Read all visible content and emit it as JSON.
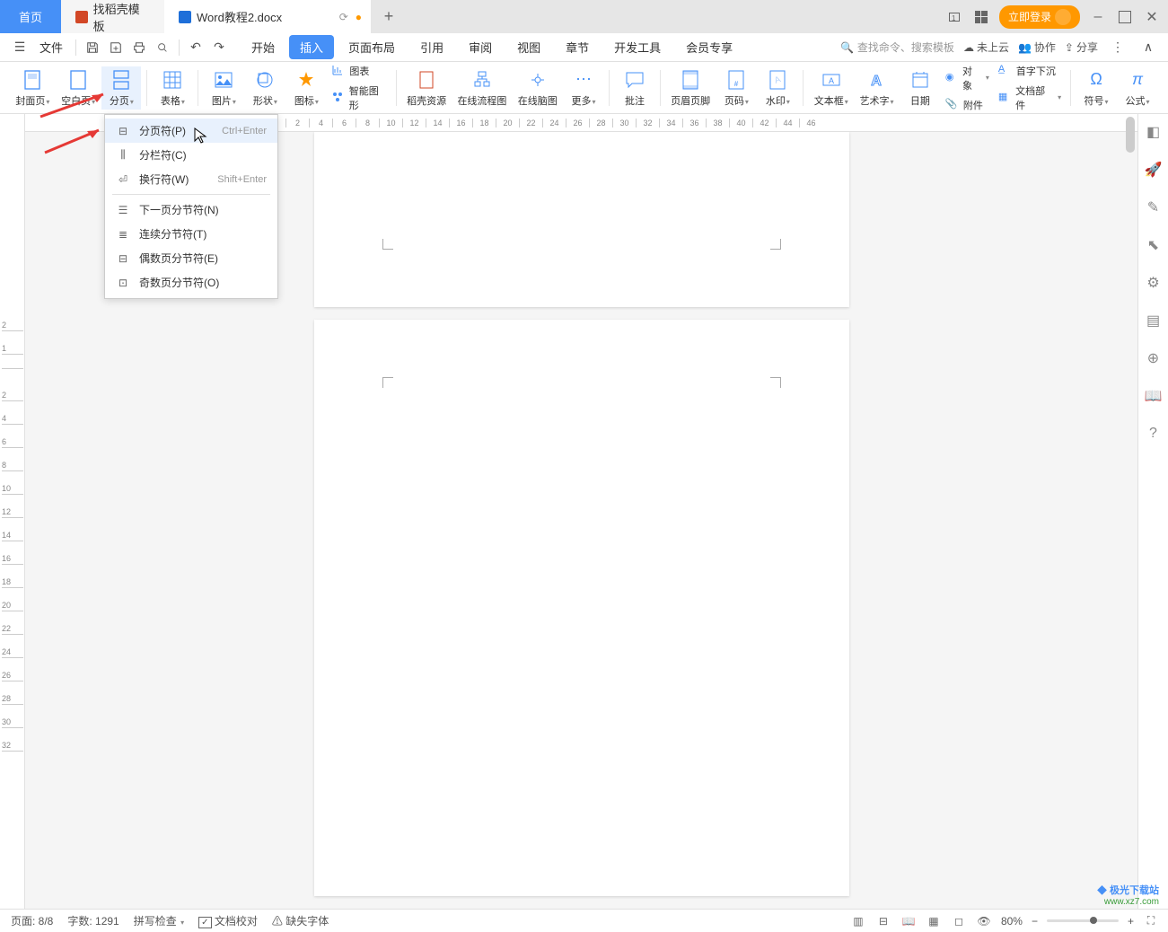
{
  "tabs": {
    "home": "首页",
    "template": "找稻壳模板",
    "doc": "Word教程2.docx",
    "add": "+"
  },
  "tabbar_right": {
    "login": "立即登录",
    "minimize": "–",
    "maximize": "□",
    "close": "✕"
  },
  "menubar": {
    "file": "文件",
    "tabs": {
      "start": "开始",
      "insert": "插入",
      "page_layout": "页面布局",
      "reference": "引用",
      "review": "审阅",
      "view": "视图",
      "chapter": "章节",
      "dev_tools": "开发工具",
      "member": "会员专享"
    },
    "search_placeholder": "查找命令、搜索模板",
    "right": {
      "cloud": "未上云",
      "collab": "协作",
      "share": "分享"
    }
  },
  "ribbon": {
    "cover": "封面页",
    "blank": "空白页",
    "page_break": "分页",
    "table": "表格",
    "image": "图片",
    "shape": "形状",
    "icon": "图标",
    "chart": "图表",
    "smart_graphic": "智能图形",
    "docer": "稻壳资源",
    "flowchart": "在线流程图",
    "mindmap": "在线脑图",
    "more": "更多",
    "comment": "批注",
    "header_footer": "页眉页脚",
    "page_no": "页码",
    "watermark": "水印",
    "textbox": "文本框",
    "wordart": "艺术字",
    "date": "日期",
    "object": "对象",
    "attachment": "附件",
    "doc_parts": "文档部件",
    "drop_cap": "首字下沉",
    "symbol": "符号",
    "formula": "公式"
  },
  "dropdown": {
    "page_break": {
      "label": "分页符(P)",
      "shortcut": "Ctrl+Enter"
    },
    "column_break": {
      "label": "分栏符(C)"
    },
    "line_break": {
      "label": "换行符(W)",
      "shortcut": "Shift+Enter"
    },
    "next_page": {
      "label": "下一页分节符(N)"
    },
    "continuous": {
      "label": "连续分节符(T)"
    },
    "even": {
      "label": "偶数页分节符(E)"
    },
    "odd": {
      "label": "奇数页分节符(O)"
    }
  },
  "hruler_marks": [
    "2",
    "4",
    "6",
    "8",
    "10",
    "12",
    "14",
    "16",
    "18",
    "20",
    "22",
    "24",
    "26",
    "28",
    "30",
    "32",
    "34",
    "36",
    "38",
    "40",
    "42",
    "44",
    "46"
  ],
  "vruler_marks": [
    "2",
    "1",
    "",
    "2",
    "4",
    "6",
    "8",
    "10",
    "12",
    "14",
    "16",
    "18",
    "20",
    "22",
    "24",
    "26",
    "28",
    "30",
    "32"
  ],
  "status": {
    "page": "页面: 8/8",
    "words": "字数: 1291",
    "spell": "拼写检查",
    "proof": "文档校对",
    "missing_font": "缺失字体",
    "zoom": "80%"
  },
  "watermark": {
    "brand": "极光下载站",
    "url": "www.xz7.com"
  }
}
